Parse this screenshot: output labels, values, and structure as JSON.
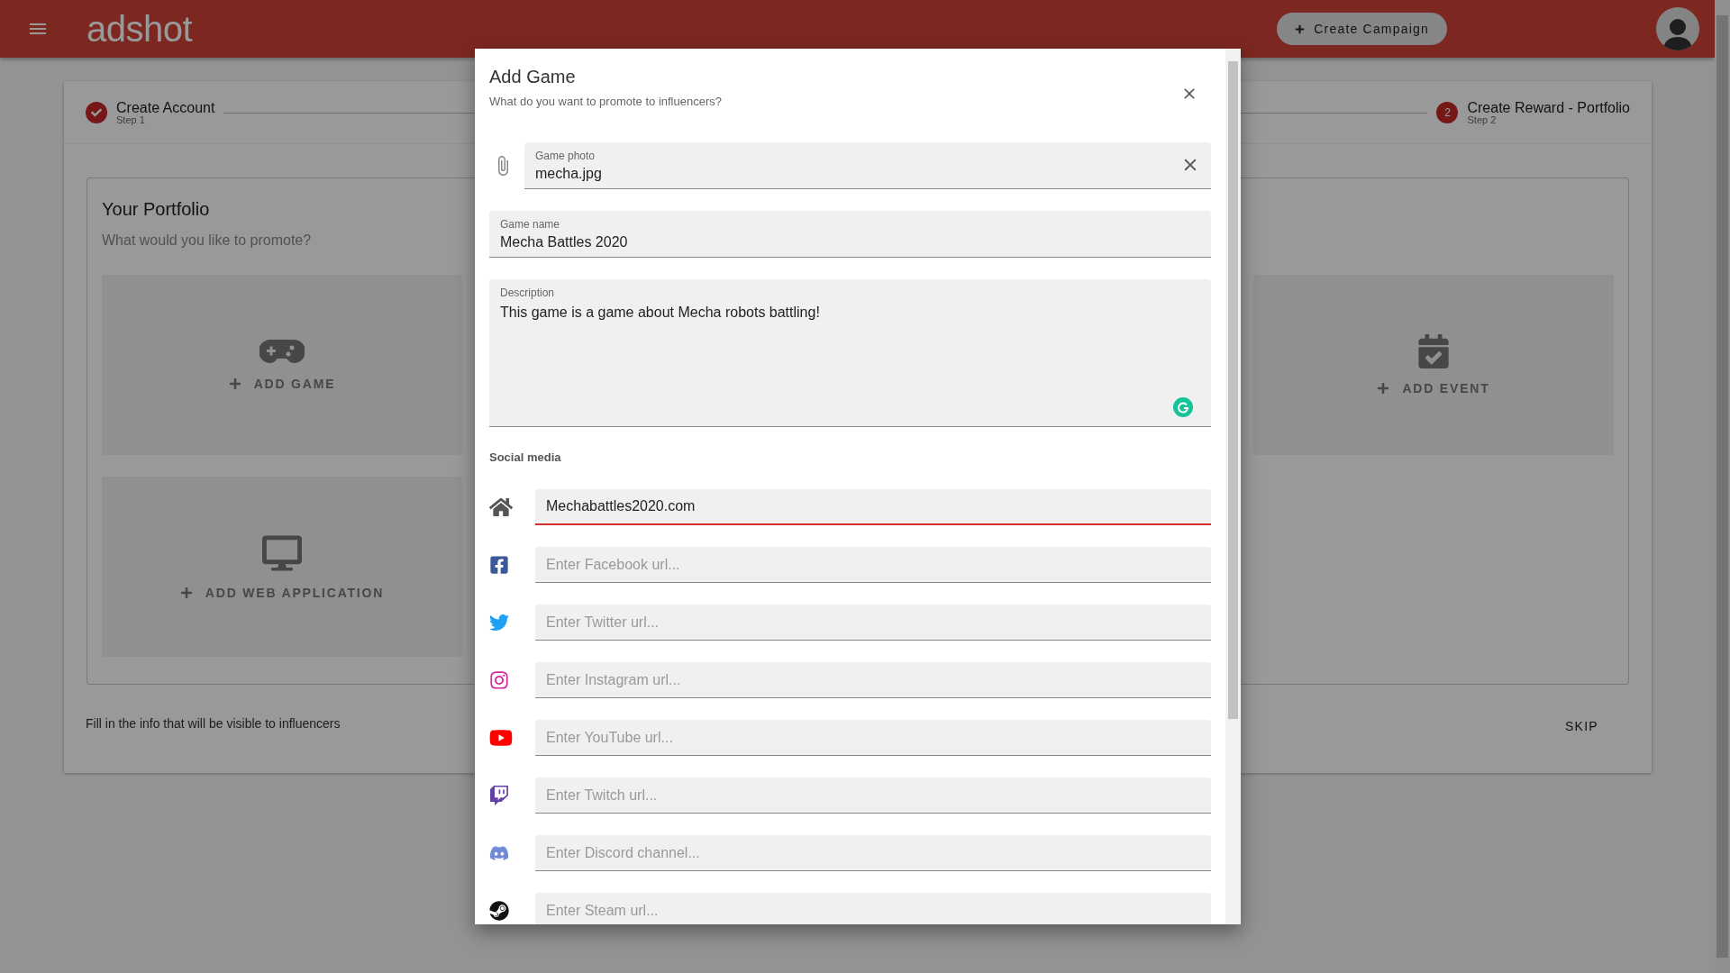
{
  "header": {
    "logo": "adshot",
    "create_button": "Create Campaign"
  },
  "stepper": {
    "steps": [
      {
        "title": "Create Account",
        "subtitle": "Step 1",
        "done": true
      },
      {
        "number": "2",
        "title": "Create Reward - Portfolio",
        "subtitle": "Step 2",
        "done": false
      }
    ]
  },
  "portfolio": {
    "title": "Your Portfolio",
    "subtitle": "What would you like to promote?",
    "tiles": [
      {
        "kind": "game",
        "label": "ADD GAME"
      },
      {
        "kind": "event",
        "label": "ADD EVENT"
      },
      {
        "kind": "web",
        "label": "ADD WEB APPLICATION"
      }
    ]
  },
  "footer_note": "Fill in the info that will be visible to influencers",
  "skip": "SKIP",
  "dialog": {
    "title": "Add Game",
    "subtitle": "What do you want to promote to influencers?",
    "photo": {
      "label": "Game photo",
      "value": "mecha.jpg"
    },
    "name": {
      "label": "Game name",
      "value": "Mecha Battles 2020"
    },
    "description": {
      "label": "Description",
      "value": "This game is a game about Mecha robots battling!"
    },
    "social_label": "Social media",
    "social": [
      {
        "kind": "website",
        "value": "Mechabattles2020.com",
        "focused": true
      },
      {
        "kind": "facebook",
        "placeholder": "Enter Facebook url...",
        "focused": false
      },
      {
        "kind": "twitter",
        "placeholder": "Enter Twitter url...",
        "focused": false
      },
      {
        "kind": "instagram",
        "placeholder": "Enter Instagram url...",
        "focused": false
      },
      {
        "kind": "youtube",
        "placeholder": "Enter YouTube url...",
        "focused": false
      },
      {
        "kind": "twitch",
        "placeholder": "Enter Twitch url...",
        "focused": false
      },
      {
        "kind": "discord",
        "placeholder": "Enter Discord channel...",
        "focused": false
      },
      {
        "kind": "steam",
        "placeholder": "Enter Steam url...",
        "focused": false
      }
    ]
  }
}
